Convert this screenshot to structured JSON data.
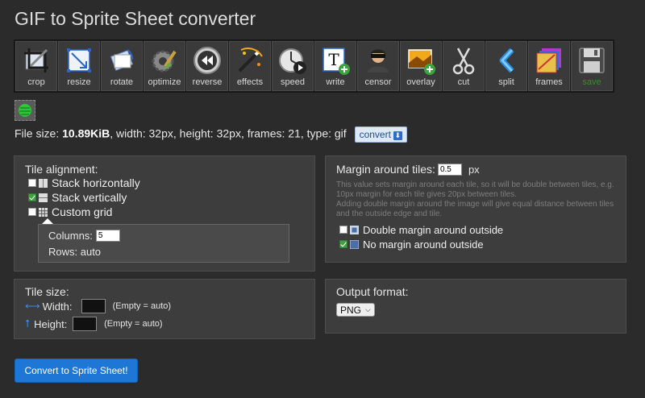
{
  "page": {
    "title": "GIF to Sprite Sheet converter"
  },
  "toolbar": {
    "items": [
      {
        "label": "crop",
        "icon": "crop-icon"
      },
      {
        "label": "resize",
        "icon": "resize-icon"
      },
      {
        "label": "rotate",
        "icon": "rotate-icon"
      },
      {
        "label": "optimize",
        "icon": "optimize-icon"
      },
      {
        "label": "reverse",
        "icon": "reverse-icon"
      },
      {
        "label": "effects",
        "icon": "effects-icon"
      },
      {
        "label": "speed",
        "icon": "speed-icon"
      },
      {
        "label": "write",
        "icon": "write-icon"
      },
      {
        "label": "censor",
        "icon": "censor-icon"
      },
      {
        "label": "overlay",
        "icon": "overlay-icon"
      },
      {
        "label": "cut",
        "icon": "cut-icon"
      },
      {
        "label": "split",
        "icon": "split-icon"
      },
      {
        "label": "frames",
        "icon": "frames-icon"
      },
      {
        "label": "save",
        "icon": "save-icon"
      }
    ]
  },
  "fileinfo": {
    "prefix": "File size: ",
    "size": "10.89KiB",
    "details": ", width: 32px, height: 32px, frames: 21, type: gif",
    "convert_label": "convert"
  },
  "alignment": {
    "title": "Tile alignment:",
    "stack_h": "Stack horizontally",
    "stack_v": "Stack vertically",
    "custom": "Custom grid",
    "columns_label": "Columns:",
    "columns_value": "5",
    "rows_label": "Rows: auto"
  },
  "margin": {
    "title": "Margin around tiles:",
    "value": "0.5",
    "unit": "px",
    "hint1": "This value sets margin around each tile, so it will be double between tiles, e.g.",
    "hint2": "10px margin for each tile gives 20px between tiles.",
    "hint3": "Adding double margin around the image will give equal distance between tiles",
    "hint4": "and the outside edge and tile.",
    "double": "Double margin around outside",
    "none": "No margin around outside"
  },
  "tilesize": {
    "title": "Tile size:",
    "width_label": "Width:",
    "height_label": "Height:",
    "note": "(Empty = auto)"
  },
  "output": {
    "title": "Output format:",
    "selected": "PNG"
  },
  "action": {
    "submit": "Convert to Sprite Sheet!"
  },
  "colors": {
    "accent": "#1e77d4",
    "check_on": "#43a047",
    "panel": "#3d3d3d",
    "background": "#2b2b2b"
  }
}
